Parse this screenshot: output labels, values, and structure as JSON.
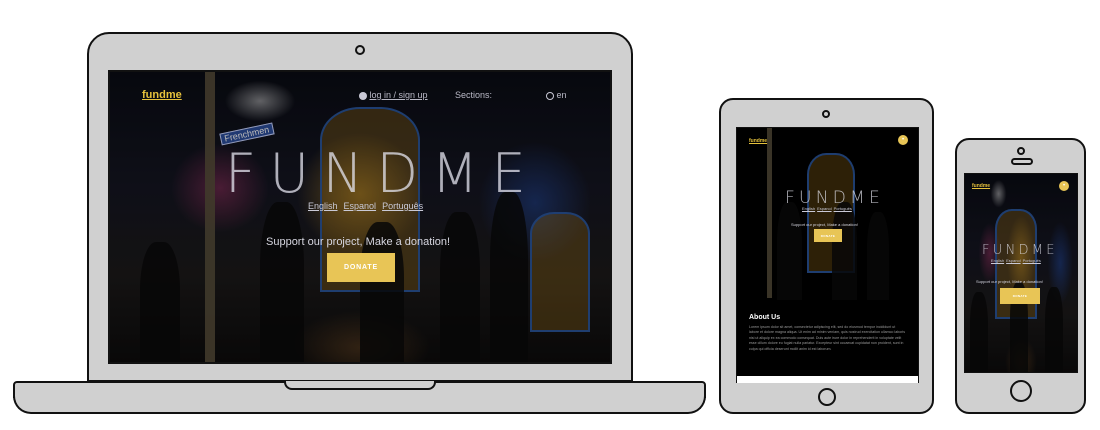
{
  "laptop": {
    "logo": "fundme",
    "login_link": "log in / sign up",
    "sections_label": "Sections:",
    "lang_label": "en",
    "hero_title": "FUNDME",
    "languages": [
      "English",
      "Espanol",
      "Português"
    ],
    "tagline": "Support our project, Make a donation!",
    "donate_label": "DONATE"
  },
  "tablet": {
    "logo": "fundme",
    "hero_title": "FUNDME",
    "languages": [
      "English",
      "Espanol",
      "Português"
    ],
    "tagline": "Support our project, Make a donation!",
    "donate_label": "DONATE",
    "about_title": "About Us",
    "about_text": "Lorem ipsum dolor sit amet, consectetur adipiscing elit, sed do eiusmod tempor incididunt ut labore et dolore magna aliqua. Ut enim ad minim veniam, quis nostrud exercitation ullamco laboris nisi ut aliquip ex ea commodo consequat. Duis aute irure dolor in reprehenderit in voluptate velit esse cillum dolore eu fugiat nulla pariatur. Excepteur sint occaecat cupidatat non proident, sunt in culpa qui officia deserunt mollit anim id est laborum."
  },
  "phone": {
    "logo": "fundme",
    "hero_title": "FUNDME",
    "languages": [
      "English",
      "Espanol",
      "Português"
    ],
    "tagline": "Support our project, Make a donation!",
    "donate_label": "DONATE"
  },
  "colors": {
    "accent": "#e8c556",
    "device_body": "#d0d0d0",
    "outline": "#111111"
  },
  "icons": {
    "user": "user-icon",
    "globe": "globe-icon",
    "menu": "menu-icon"
  }
}
